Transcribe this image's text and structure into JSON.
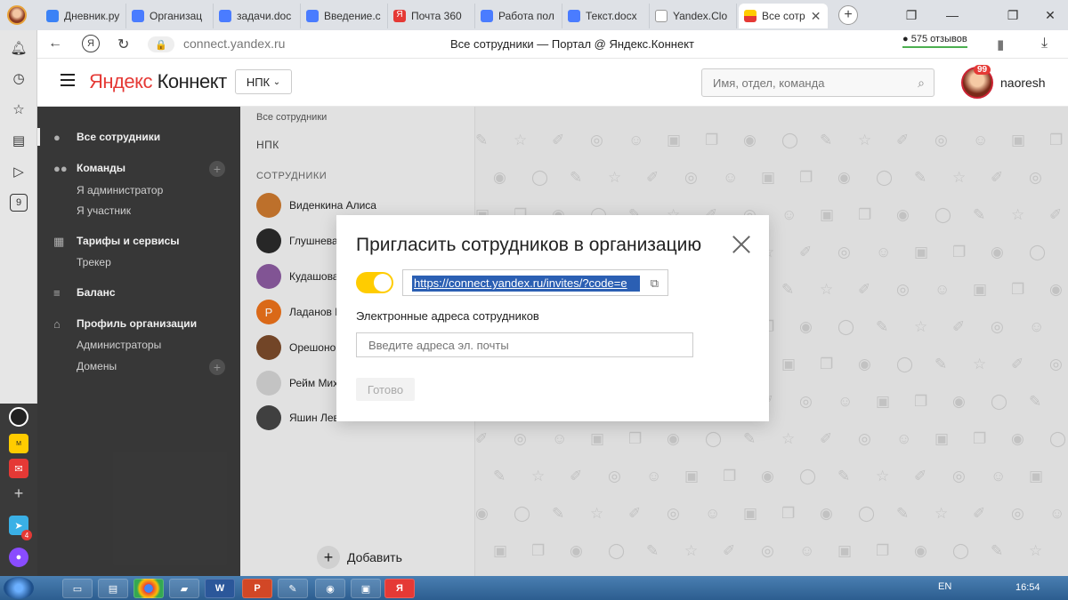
{
  "browser": {
    "tabs": [
      {
        "title": "Дневник.ру",
        "color": "#3b82f6"
      },
      {
        "title": "Организац",
        "color": "#4a7cff"
      },
      {
        "title": "задачи.doc",
        "color": "#4a7cff"
      },
      {
        "title": "Введение.c",
        "color": "#4a7cff"
      },
      {
        "title": "Почта 360",
        "color": "#e53935"
      },
      {
        "title": "Работа пол",
        "color": "#4a7cff"
      },
      {
        "title": "Текст.docx",
        "color": "#4a7cff"
      },
      {
        "title": "Yandex.Clo",
        "color": "#999999"
      },
      {
        "title": "Все сотр",
        "color": "#e53935"
      }
    ],
    "url": "connect.yandex.ru",
    "page_title": "Все сотрудники — Портал @ Яндекс.Коннект",
    "reviews": "575 отзывов"
  },
  "browser_sidebar": {
    "badge_count": "4",
    "nine": "9"
  },
  "header": {
    "logo_part1": "Яндекс",
    "logo_part2": "Коннект",
    "org": "НПК",
    "search_placeholder": "Имя, отдел, команда",
    "notifications": "99",
    "username": "naoresh"
  },
  "sidebar": {
    "items": [
      {
        "label": "Все сотрудники"
      },
      {
        "label": "Команды"
      },
      {
        "label": "Я администратор"
      },
      {
        "label": "Я участник"
      },
      {
        "label": "Тарифы и сервисы"
      },
      {
        "label": "Трекер"
      },
      {
        "label": "Баланс"
      },
      {
        "label": "Профиль организации"
      },
      {
        "label": "Администраторы"
      },
      {
        "label": "Домены"
      }
    ]
  },
  "content": {
    "breadcrumb": "Все сотрудники",
    "org_section": "НПК",
    "employees_section": "СОТРУДНИКИ",
    "employees": [
      {
        "name": "Виденкина Алиса",
        "initial": "",
        "color": "#c9782e"
      },
      {
        "name": "Глушнева",
        "initial": "",
        "color": "#2a2a2a"
      },
      {
        "name": "Кудашова",
        "initial": "",
        "color": "#8a5a9e"
      },
      {
        "name": "Ладанов Р",
        "initial": "Р",
        "color": "#e8701a"
      },
      {
        "name": "Орешонок",
        "initial": "",
        "color": "#7a4a2a"
      },
      {
        "name": "Рейм Мих",
        "initial": "",
        "color": "#d0d0d0"
      },
      {
        "name": "Яшин Лев",
        "initial": "",
        "color": "#444444"
      }
    ],
    "add_label": "Добавить"
  },
  "modal": {
    "title": "Пригласить сотрудников в организацию",
    "invite_link": "https://connect.yandex.ru/invites/?code=e",
    "emails_label": "Электронные адреса сотрудников",
    "emails_placeholder": "Введите адреса эл. почты",
    "done_label": "Готово",
    "link_enabled": true
  },
  "taskbar": {
    "lang": "EN",
    "time": "16:54"
  }
}
